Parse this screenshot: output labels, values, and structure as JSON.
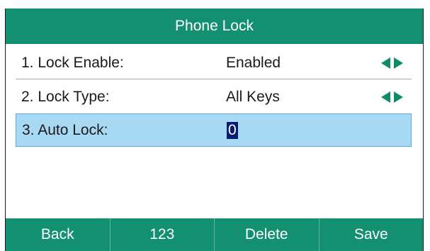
{
  "title": "Phone Lock",
  "rows": [
    {
      "label": "1. Lock Enable:",
      "value": "Enabled",
      "has_arrows": true
    },
    {
      "label": "2. Lock Type:",
      "value": "All Keys",
      "has_arrows": true
    },
    {
      "label": "3. Auto Lock:",
      "value": "0",
      "has_arrows": false,
      "selected": true
    }
  ],
  "softkeys": [
    "Back",
    "123",
    "Delete",
    "Save"
  ],
  "colors": {
    "accent": "#138f72",
    "selection": "#a7d8f4",
    "cursor": "#0c1c6f",
    "arrow": "#0f8a6a"
  }
}
